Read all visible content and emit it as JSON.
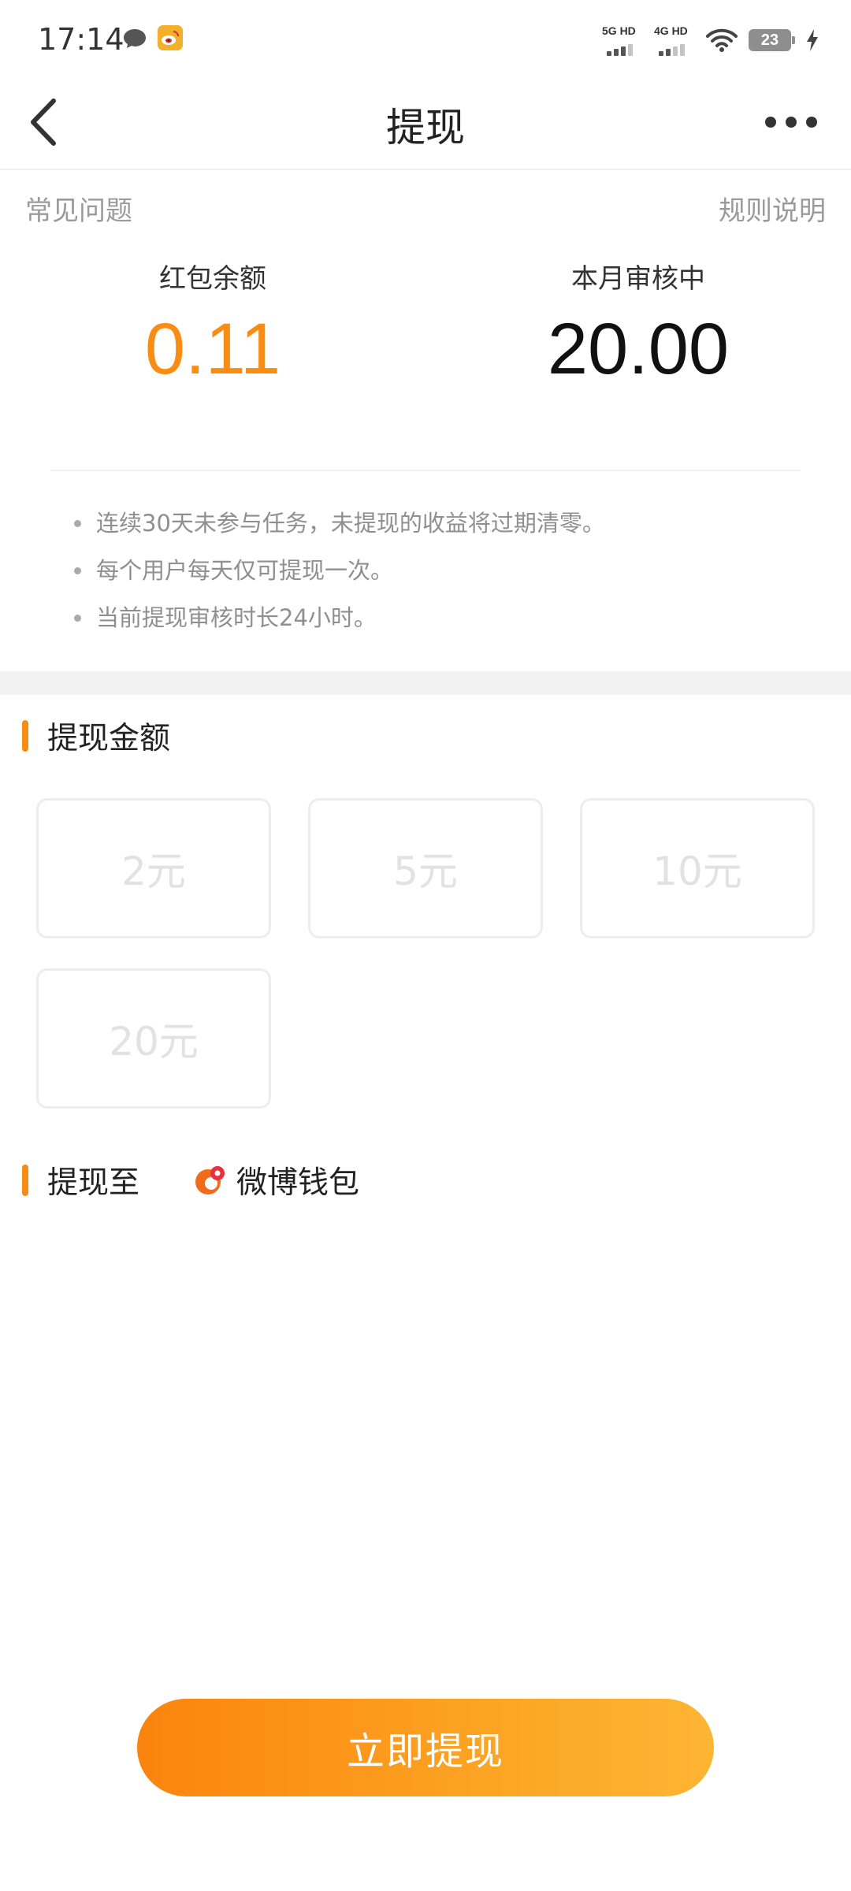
{
  "status_bar": {
    "time": "17:14",
    "signal_1_label": "5G HD",
    "signal_2_label": "4G HD",
    "battery_level": "23",
    "icons": [
      "message-icon",
      "weibo-app-icon",
      "signal-icon",
      "wifi-icon",
      "battery-icon",
      "charging-icon"
    ]
  },
  "nav": {
    "title": "提现",
    "back_icon": "chevron-left-icon",
    "more_icon": "more-icon"
  },
  "links": {
    "faq": "常见问题",
    "rules": "规则说明"
  },
  "balances": {
    "red_packet_label": "红包余额",
    "red_packet_value": "0.11",
    "reviewing_label": "本月审核中",
    "reviewing_value": "20.00"
  },
  "tips": [
    "连续30天未参与任务，未提现的收益将过期清零。",
    "每个用户每天仅可提现一次。",
    "当前提现审核时长24小时。"
  ],
  "amount_section": {
    "title": "提现金额",
    "options": [
      "2元",
      "5元",
      "10元",
      "20元"
    ]
  },
  "destination_section": {
    "title": "提现至",
    "wallet_label": "微博钱包"
  },
  "withdraw_button": "立即提现",
  "colors": {
    "accent": "#f98c13",
    "button_gradient_start": "#fb830e",
    "button_gradient_end": "#fdb533",
    "muted_text": "#9a9a9a"
  }
}
